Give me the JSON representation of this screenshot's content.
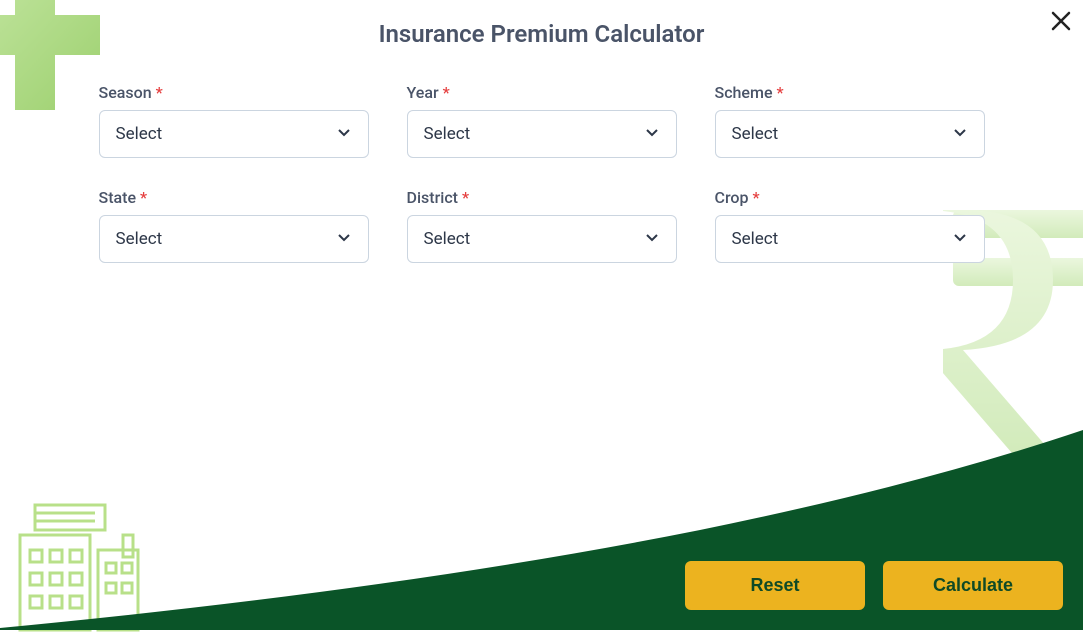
{
  "title": "Insurance Premium Calculator",
  "fields": {
    "season": {
      "label": "Season",
      "placeholder": "Select"
    },
    "year": {
      "label": "Year",
      "placeholder": "Select"
    },
    "scheme": {
      "label": "Scheme",
      "placeholder": "Select"
    },
    "state": {
      "label": "State",
      "placeholder": "Select"
    },
    "district": {
      "label": "District",
      "placeholder": "Select"
    },
    "crop": {
      "label": "Crop",
      "placeholder": "Select"
    }
  },
  "required_marker": "*",
  "buttons": {
    "reset": "Reset",
    "calculate": "Calculate"
  }
}
